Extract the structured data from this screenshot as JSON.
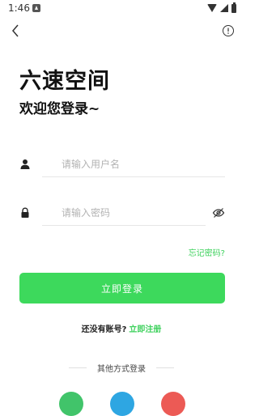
{
  "status_bar": {
    "time": "1:46"
  },
  "header": {
    "app_title": "六速空间",
    "welcome": "欢迎您登录~"
  },
  "form": {
    "username_placeholder": "请输入用户名",
    "password_placeholder": "请输入密码",
    "forgot_password": "忘记密码?",
    "login_button": "立即登录"
  },
  "register": {
    "prompt": "还没有账号?",
    "link": "立即注册"
  },
  "other_login": {
    "label": "其他方式登录"
  },
  "colors": {
    "accent": "#3dd95c",
    "wechat": "#41c46a",
    "qq": "#2ea6e2",
    "weibo": "#ec5a55"
  }
}
